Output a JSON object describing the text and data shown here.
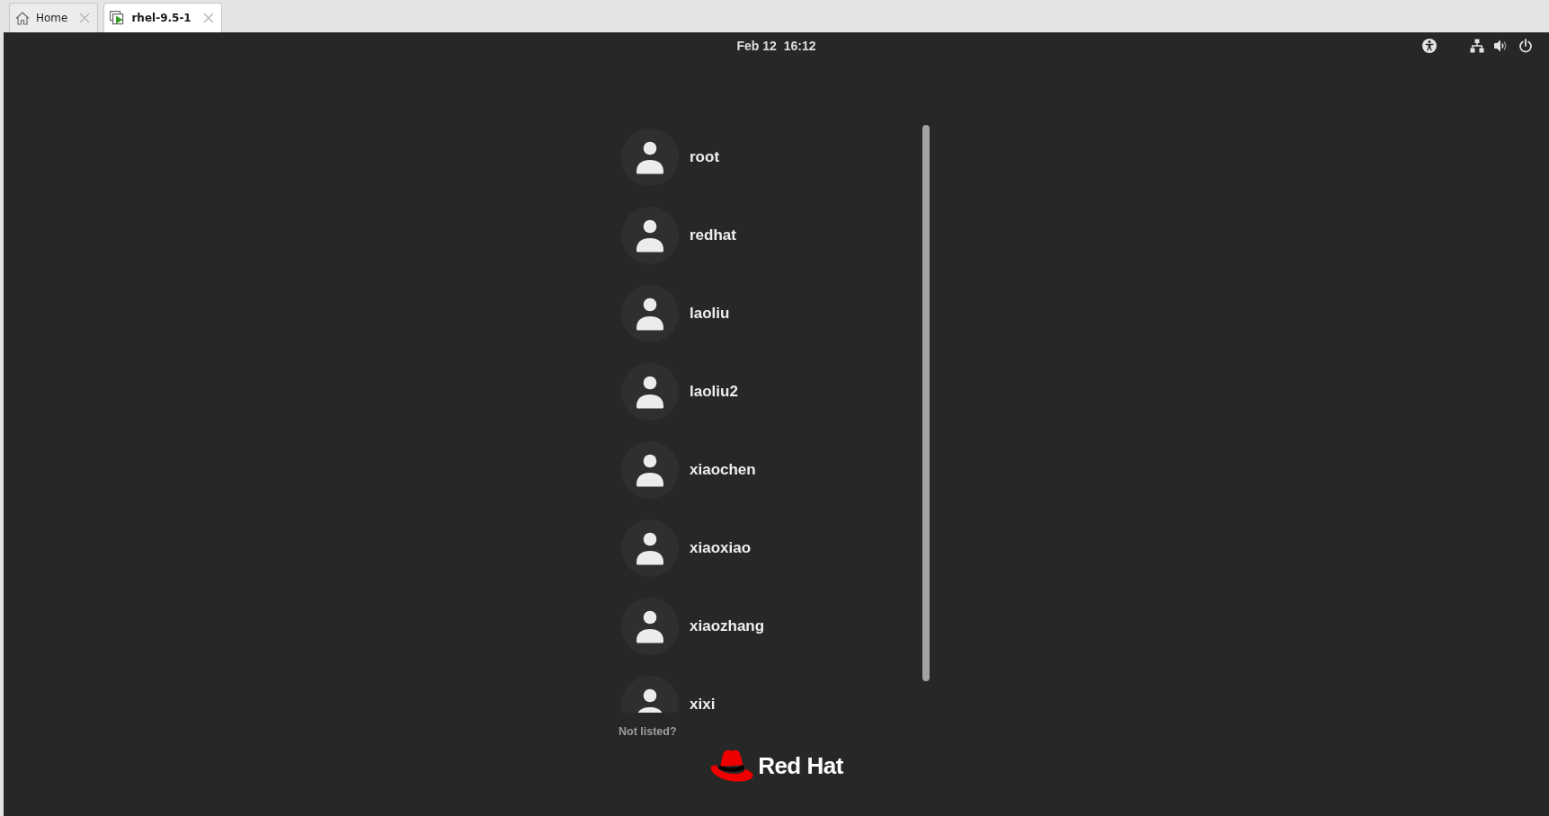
{
  "browser_tabs": [
    {
      "label": "Home",
      "kind": "home",
      "selected": false
    },
    {
      "label": "rhel-9.5-1",
      "kind": "vm",
      "selected": true
    }
  ],
  "top_bar": {
    "datetime": "Feb 12  16:12"
  },
  "users": [
    {
      "name": "root"
    },
    {
      "name": "redhat"
    },
    {
      "name": "laoliu"
    },
    {
      "name": "laoliu2"
    },
    {
      "name": "xiaochen"
    },
    {
      "name": "xiaoxiao"
    },
    {
      "name": "xiaozhang"
    },
    {
      "name": "xixi"
    }
  ],
  "not_listed": "Not listed?",
  "logo": {
    "text": "Red Hat"
  }
}
